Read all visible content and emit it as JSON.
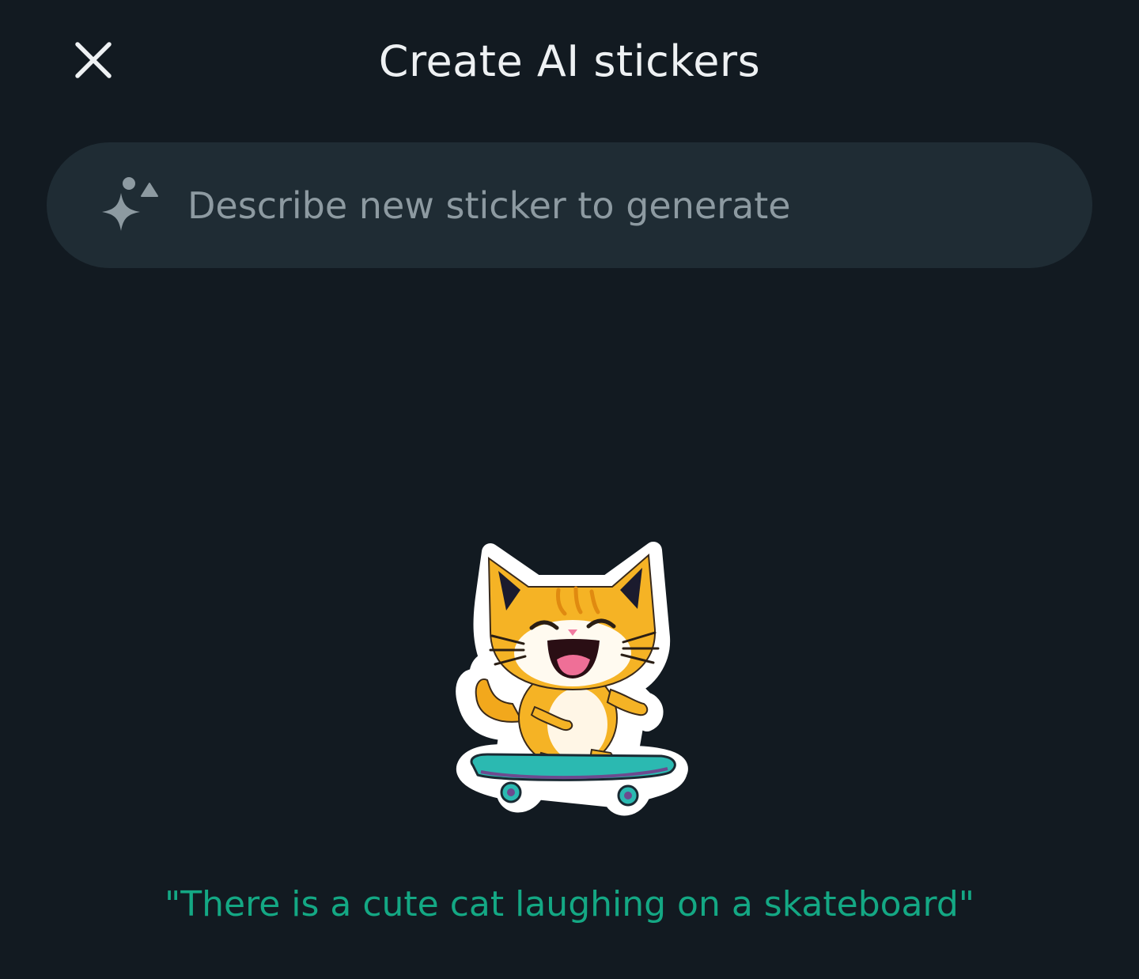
{
  "header": {
    "title": "Create AI stickers",
    "close_icon": "close-icon"
  },
  "search": {
    "placeholder": "Describe new sticker to generate",
    "icon": "sparkle-icon"
  },
  "sticker": {
    "subject": "cat-on-skateboard-sticker"
  },
  "example": {
    "text": "\"There is a cute cat laughing on a skateboard\""
  },
  "colors": {
    "background": "#121a21",
    "search_bar": "#1f2c34",
    "title": "#eef1f3",
    "placeholder": "#8d9aa1",
    "accent_green": "#14a884"
  }
}
